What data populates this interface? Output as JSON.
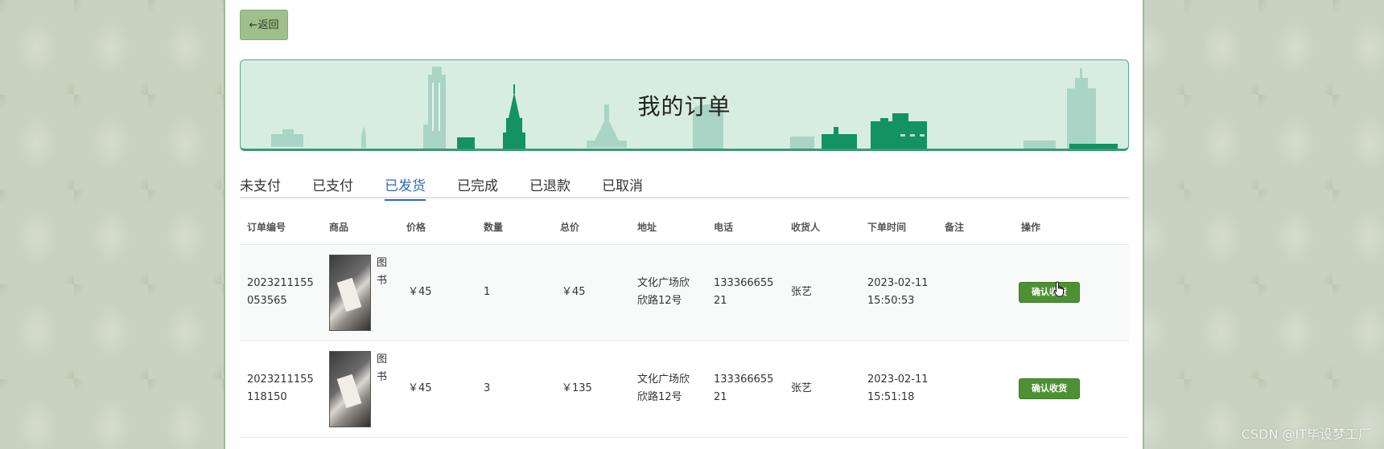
{
  "back_button": {
    "label": "←返回"
  },
  "banner": {
    "title": "我的订单"
  },
  "tabs": [
    {
      "label": "未支付",
      "active": false
    },
    {
      "label": "已支付",
      "active": false
    },
    {
      "label": "已发货",
      "active": true
    },
    {
      "label": "已完成",
      "active": false
    },
    {
      "label": "已退款",
      "active": false
    },
    {
      "label": "已取消",
      "active": false
    }
  ],
  "table": {
    "headers": [
      "订单编号",
      "商品",
      "价格",
      "数量",
      "总价",
      "地址",
      "电话",
      "收货人",
      "下单时间",
      "备注",
      "操作"
    ],
    "rows": [
      {
        "order_no_1": "2023211155",
        "order_no_2": "053565",
        "goods_1": "图",
        "goods_2": "书",
        "price": "￥45",
        "qty": "1",
        "total": "￥45",
        "addr_1": "文化广场欣",
        "addr_2": "欣路12号",
        "phone_1": "133366655",
        "phone_2": "21",
        "receiver": "张艺",
        "time_1": "2023-02-11",
        "time_2": "15:50:53",
        "remark": "",
        "action": "确认收货"
      },
      {
        "order_no_1": "2023211155",
        "order_no_2": "118150",
        "goods_1": "图",
        "goods_2": "书",
        "price": "￥45",
        "qty": "3",
        "total": "￥135",
        "addr_1": "文化广场欣",
        "addr_2": "欣路12号",
        "phone_1": "133366655",
        "phone_2": "21",
        "receiver": "张艺",
        "time_1": "2023-02-11",
        "time_2": "15:51:18",
        "remark": "",
        "action": "确认收货"
      }
    ]
  },
  "watermark": "CSDN @IT毕设梦工厂",
  "colors": {
    "accent": "#2f6bb5",
    "confirm_button": "#4d9134",
    "banner_bg": "#d8ede2",
    "back_button": "#9fbf8b"
  },
  "icons": {
    "cursor": "hand-pointer-icon"
  }
}
